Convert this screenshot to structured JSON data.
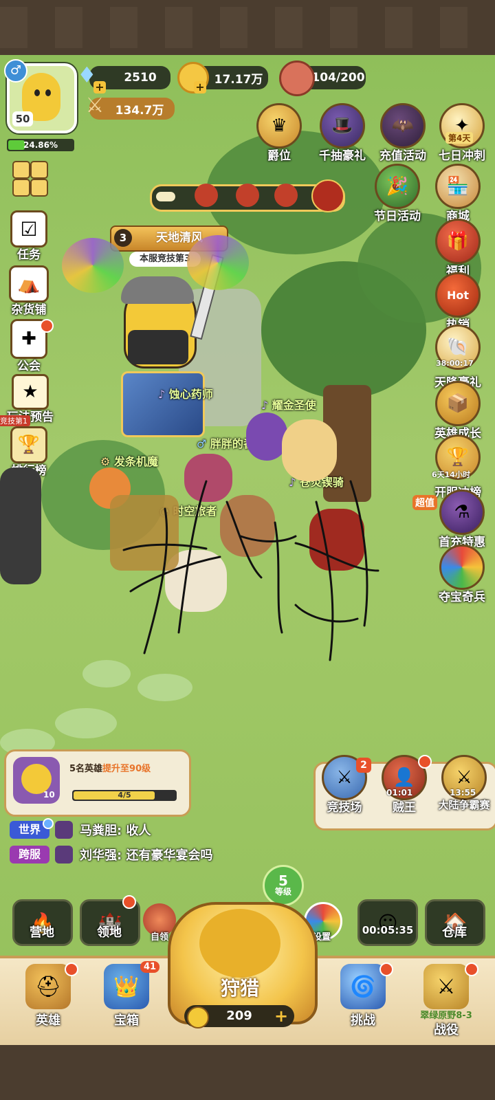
{
  "player": {
    "level": "50",
    "exp": "24.86%",
    "power": "134.7万"
  },
  "resources": {
    "gems": "2510",
    "gold": "17.17万",
    "meat": "104/200"
  },
  "top_buttons": [
    {
      "label": "爵位",
      "icon": "crown-emblem-icon"
    },
    {
      "label": "千抽豪礼",
      "icon": "wizard-icon"
    },
    {
      "label": "充值活动",
      "icon": "bat-icon"
    },
    {
      "label": "七日冲刺",
      "icon": "seven-day-icon",
      "badge": "第4天"
    }
  ],
  "right_buttons": [
    {
      "label": "节日活动"
    },
    {
      "label": "商城"
    },
    {
      "label": "福利"
    },
    {
      "label": "热销",
      "badge": "Hot"
    },
    {
      "label": "天降豪礼",
      "timer": "38:00:17"
    },
    {
      "label": "英雄成长"
    },
    {
      "label": "开服冲榜",
      "timer": "6天14小时"
    },
    {
      "label": "首充特惠",
      "badge": "超值"
    },
    {
      "label": "夺宝奇兵"
    }
  ],
  "left_buttons": [
    {
      "label": "任务"
    },
    {
      "label": "杂货铺"
    },
    {
      "label": "公会"
    },
    {
      "label": "玩法预告",
      "sub": "竞技第1"
    },
    {
      "label": "排行榜"
    }
  ],
  "champion": {
    "rank": "3",
    "name": "天地清风",
    "title": "本服竞技第3"
  },
  "heroes": [
    {
      "name": "蚀心药师"
    },
    {
      "name": "耀金圣使"
    },
    {
      "name": "胖胖的番茄"
    },
    {
      "name": "发条机魔"
    },
    {
      "name": "苍炎锲骑"
    },
    {
      "name": "时空旅者"
    }
  ],
  "quest": {
    "text_prefix": "5名英雄",
    "text_highlight": "提升至90级",
    "progress": "4/5",
    "progress_value": 0.8,
    "badge_level": "10"
  },
  "events": [
    {
      "label": "竞技场",
      "badge": "2"
    },
    {
      "label": "贼王",
      "timer": "01:01"
    },
    {
      "label": "大陆争霸赛",
      "timer": "13:55"
    }
  ],
  "chat": [
    {
      "channel": "世界",
      "text": "马粪胆: 收人"
    },
    {
      "channel": "跨服",
      "text": "刘华强: 还有豪华宴会吗"
    }
  ],
  "mid_buttons": {
    "camp": "营地",
    "territory": "领地",
    "claim": "自领",
    "level_num": "5",
    "level_label": "等级",
    "settings": "设置",
    "timer": "00:05:35",
    "warehouse": "仓库"
  },
  "bottom": {
    "hero": "英雄",
    "chest": "宝箱",
    "chest_badge": "41",
    "hunt": "狩猎",
    "hunt_cost": "209",
    "challenge": "挑战",
    "battle": "战役",
    "stage": "翠绿原野8-3"
  },
  "colors": {
    "accent": "#f2b52c",
    "dark_pill": "#2f3a25",
    "badge_red": "#e8502a",
    "grass": "#9fc765"
  }
}
